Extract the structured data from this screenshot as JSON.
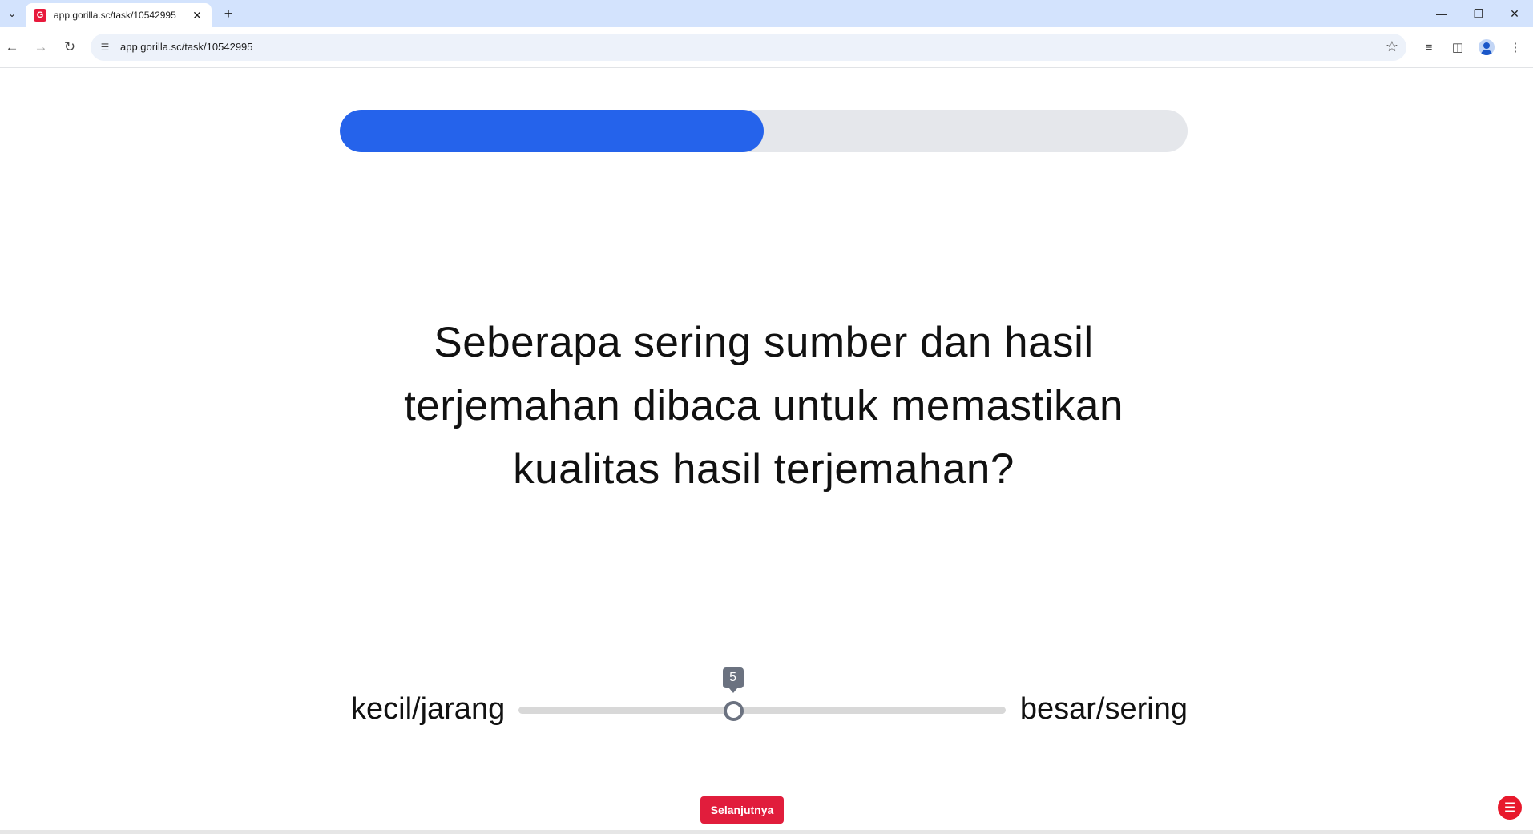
{
  "browser": {
    "tab_title": "app.gorilla.sc/task/10542995",
    "favicon_letter": "G",
    "url": "app.gorilla.sc/task/10542995",
    "icons": {
      "tab_search": "chevron-down-icon",
      "tab_close": "close-icon",
      "new_tab": "plus-icon",
      "minimize": "minimize-icon",
      "restore": "restore-icon",
      "close_window": "close-icon",
      "back": "arrow-left-icon",
      "forward": "arrow-right-icon",
      "reload": "reload-icon",
      "site_info": "tune-icon",
      "bookmark": "star-icon",
      "media": "media-queue-icon",
      "side_panel": "side-panel-icon",
      "profile": "avatar-icon",
      "menu": "kebab-menu-icon"
    }
  },
  "task": {
    "progress_fraction": 0.5,
    "progress_color": "#2563eb",
    "question": "Seberapa sering sumber dan hasil terjemahan dibaca untuk memastikan kualitas hasil terjemahan?",
    "slider": {
      "min_label": "kecil/jarang",
      "max_label": "besar/sering",
      "value": "5",
      "min": 1,
      "max": 10
    },
    "next_button": "Selanjutnya",
    "accent_color": "#e11d3c",
    "menu_icon": "hamburger-menu-icon"
  }
}
